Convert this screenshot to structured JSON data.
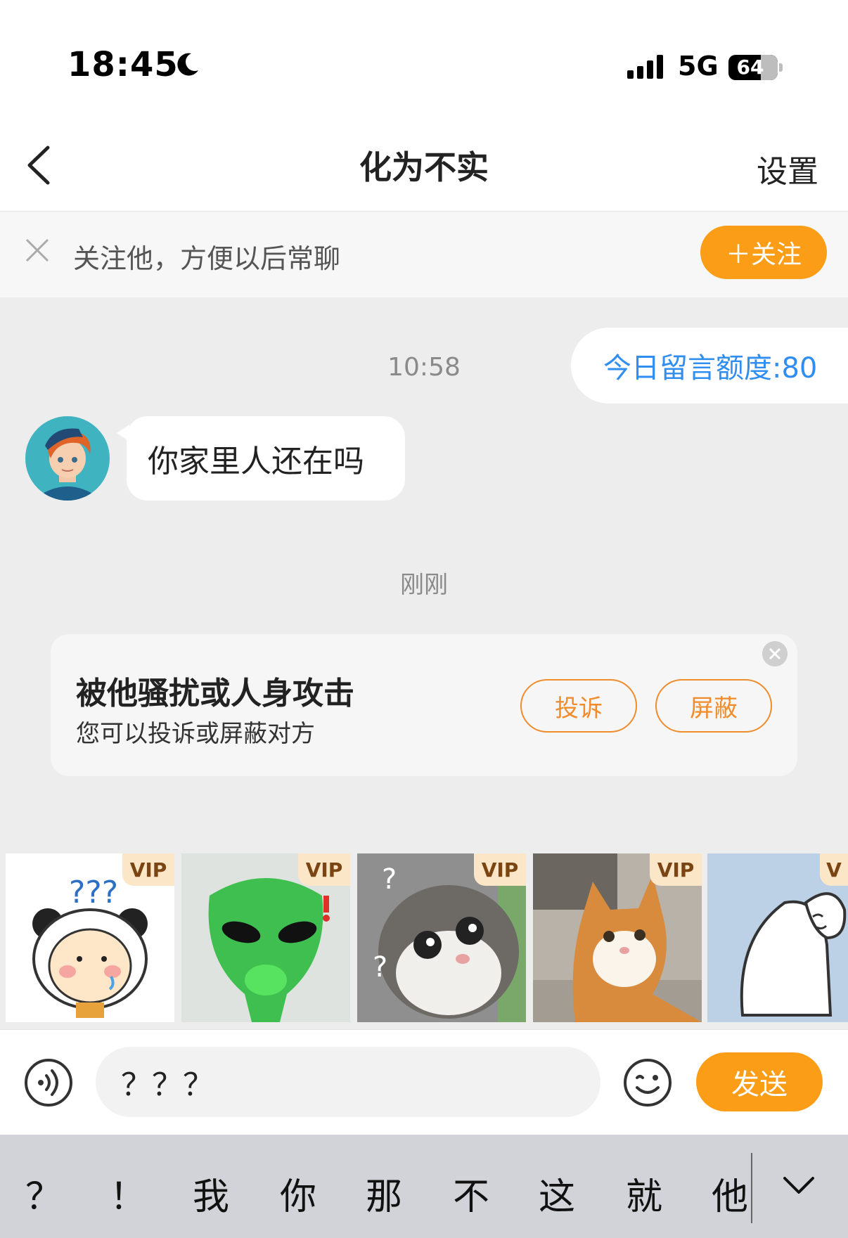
{
  "status_bar": {
    "time": "18:45",
    "network": "5G",
    "battery": "64"
  },
  "nav": {
    "title": "化为不实",
    "settings_label": "设置"
  },
  "follow_banner": {
    "text": "关注他，方便以后常聊",
    "follow_label": "＋关注"
  },
  "chat": {
    "timestamp_1": "10:58",
    "quota_text": "今日留言额度:80",
    "incoming_message": "你家里人还在吗",
    "timestamp_2": "刚刚"
  },
  "report_card": {
    "title": "被他骚扰或人身攻击",
    "subtitle": "您可以投诉或屏蔽对方",
    "complain_label": "投诉",
    "block_label": "屏蔽"
  },
  "stickers": [
    {
      "badge": "VIP",
      "icon": "panda-question-sticker"
    },
    {
      "badge": "VIP",
      "icon": "green-alien-sticker"
    },
    {
      "badge": "VIP",
      "icon": "confused-tabby-cat-sticker"
    },
    {
      "badge": "VIP",
      "icon": "orange-cat-sticker"
    },
    {
      "badge": "V",
      "icon": "ghost-sticker"
    }
  ],
  "input_bar": {
    "value": "？？？",
    "send_label": "发送"
  },
  "keyboard_suggestions": [
    "？",
    "！",
    "我",
    "你",
    "那",
    "不",
    "这",
    "就",
    "他"
  ],
  "colors": {
    "accent": "#fb9d17",
    "link_blue": "#2f8ef0",
    "report_orange": "#f08c2c"
  }
}
